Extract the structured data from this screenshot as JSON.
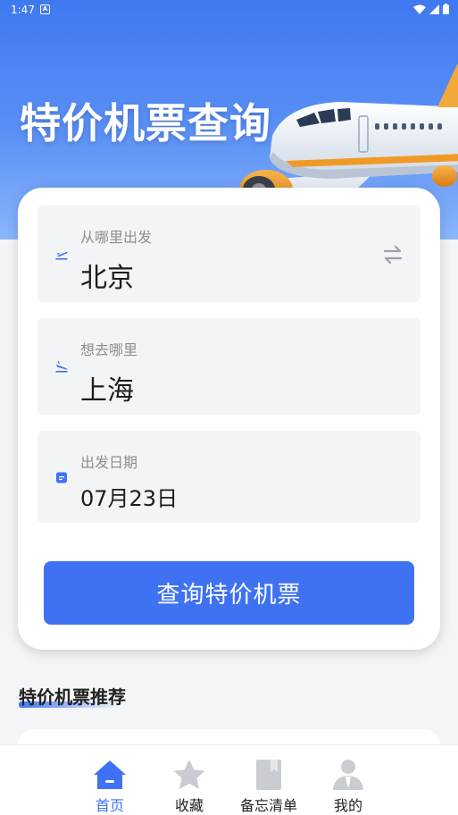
{
  "status_bar": {
    "time": "1:47",
    "notif_icon": "A"
  },
  "hero": {
    "title": "特价机票查询"
  },
  "form": {
    "from": {
      "label": "从哪里出发",
      "value": "北京"
    },
    "to": {
      "label": "想去哪里",
      "value": "上海"
    },
    "date": {
      "label": "出发日期",
      "value": "07月23日"
    },
    "search_button": "查询特价机票"
  },
  "recommend": {
    "title": "特价机票推荐"
  },
  "nav": [
    {
      "label": "首页",
      "icon": "home-icon",
      "active": true
    },
    {
      "label": "收藏",
      "icon": "star-icon",
      "active": false
    },
    {
      "label": "备忘清单",
      "icon": "bookmark-icon",
      "active": false
    },
    {
      "label": "我的",
      "icon": "user-icon",
      "active": false
    }
  ],
  "colors": {
    "accent": "#3e72f2",
    "hero_top": "#3f79f0",
    "inactive_icon": "#c9ccd1"
  }
}
